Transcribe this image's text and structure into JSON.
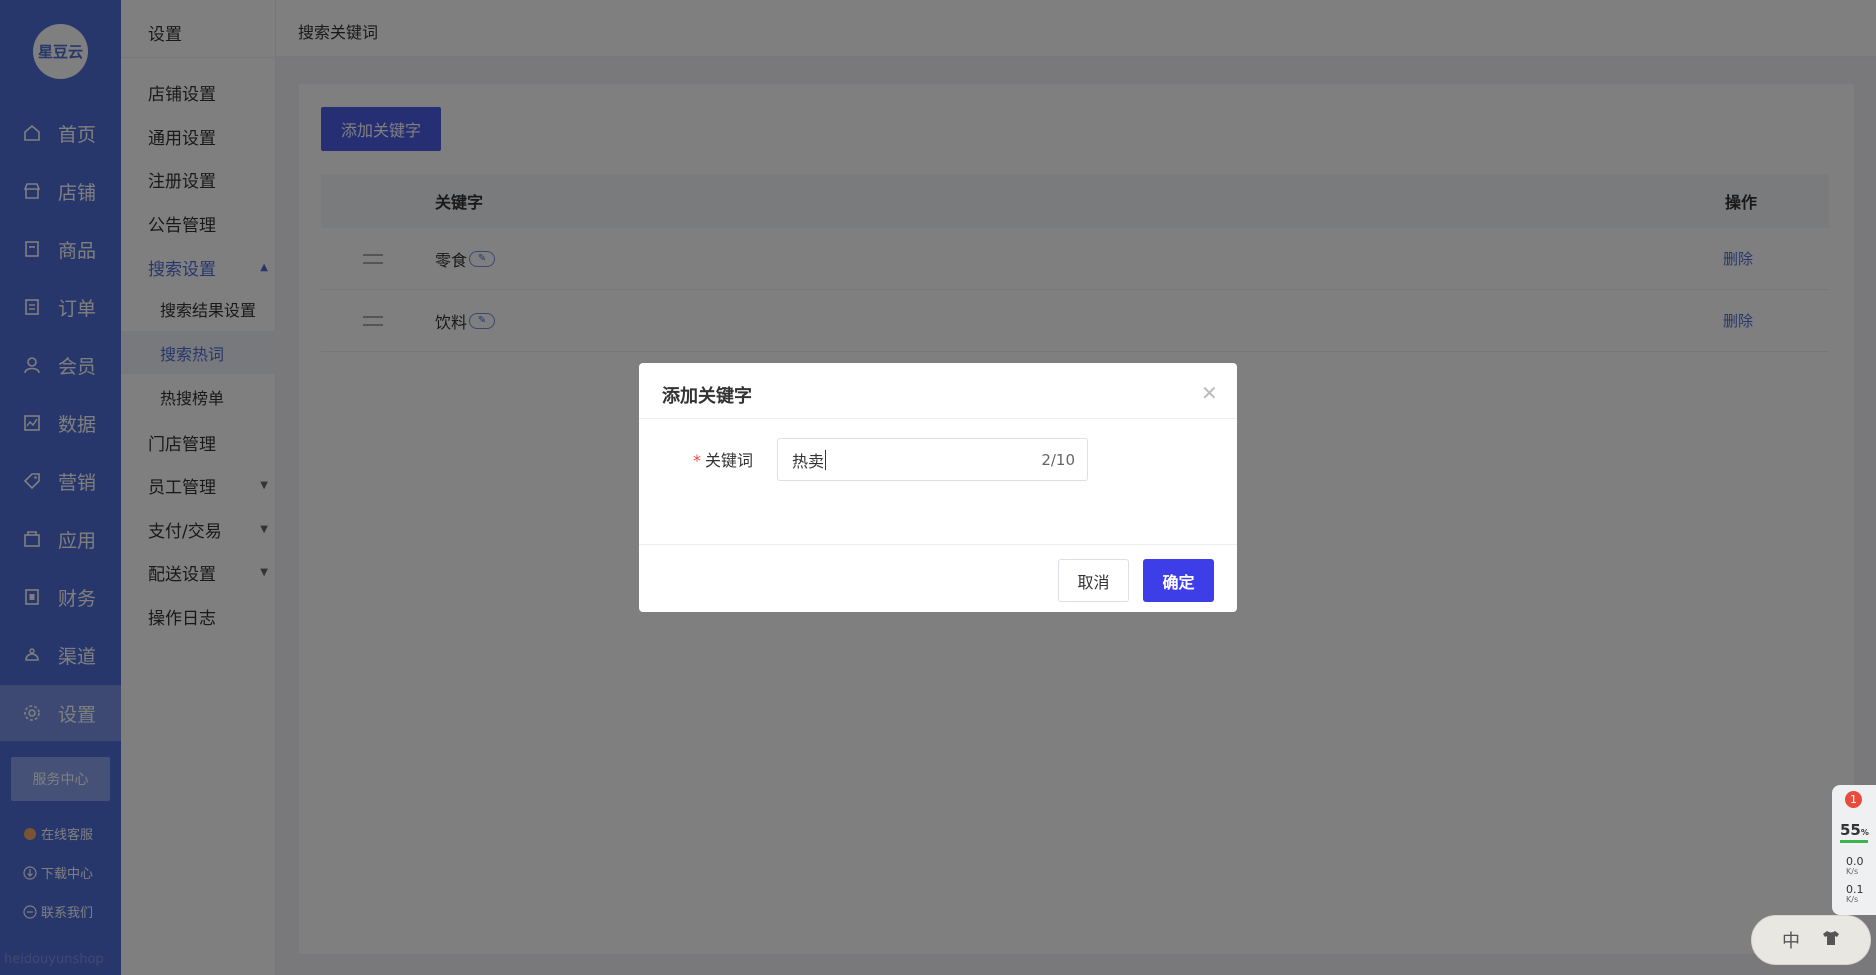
{
  "sidebar": {
    "logo": "星豆云",
    "items": [
      {
        "label": "首页",
        "icon": "home-icon"
      },
      {
        "label": "店铺",
        "icon": "store-icon"
      },
      {
        "label": "商品",
        "icon": "goods-icon"
      },
      {
        "label": "订单",
        "icon": "order-icon"
      },
      {
        "label": "会员",
        "icon": "member-icon"
      },
      {
        "label": "数据",
        "icon": "data-icon"
      },
      {
        "label": "营销",
        "icon": "tag-icon"
      },
      {
        "label": "应用",
        "icon": "app-icon"
      },
      {
        "label": "财务",
        "icon": "finance-icon"
      },
      {
        "label": "渠道",
        "icon": "channel-icon"
      },
      {
        "label": "设置",
        "icon": "gear-icon"
      }
    ],
    "service_center": "服务中心",
    "online_service": "在线客服",
    "download_center": "下载中心",
    "contact_us": "联系我们",
    "watermark": "heidouyunshop"
  },
  "submenu": {
    "title": "设置",
    "items": {
      "shop_settings": "店铺设置",
      "general_settings": "通用设置",
      "register_settings": "注册设置",
      "notice_management": "公告管理",
      "search_settings": "搜索设置",
      "search_result_settings": "搜索结果设置",
      "search_hot_words": "搜索热词",
      "hot_search_list": "热搜榜单",
      "store_management": "门店管理",
      "staff_management": "员工管理",
      "payment_trade": "支付/交易",
      "delivery_settings": "配送设置",
      "operation_log": "操作日志"
    }
  },
  "header": {
    "title": "搜索关键词"
  },
  "main": {
    "add_button": "添加关键字",
    "table": {
      "col_keyword": "关键字",
      "col_action": "操作",
      "rows": [
        {
          "keyword": "零食",
          "action": "删除"
        },
        {
          "keyword": "饮料",
          "action": "删除"
        }
      ]
    }
  },
  "dialog": {
    "title": "添加关键字",
    "field_required": "*",
    "field_label": "关键词",
    "field_value": "热卖",
    "field_count": "2/10",
    "cancel": "取消",
    "confirm": "确定"
  },
  "widget": {
    "badge": "1",
    "percent": "55",
    "percent_unit": "%",
    "up_rate": "0.0",
    "down_rate": "0.1",
    "rate_unit": "K/s",
    "ime_label": "中"
  },
  "colors": {
    "sidebar": "#4f6fd8",
    "primary_button": "#3d3ee8",
    "accent": "#4f5ee8",
    "required": "#e84c3d"
  }
}
